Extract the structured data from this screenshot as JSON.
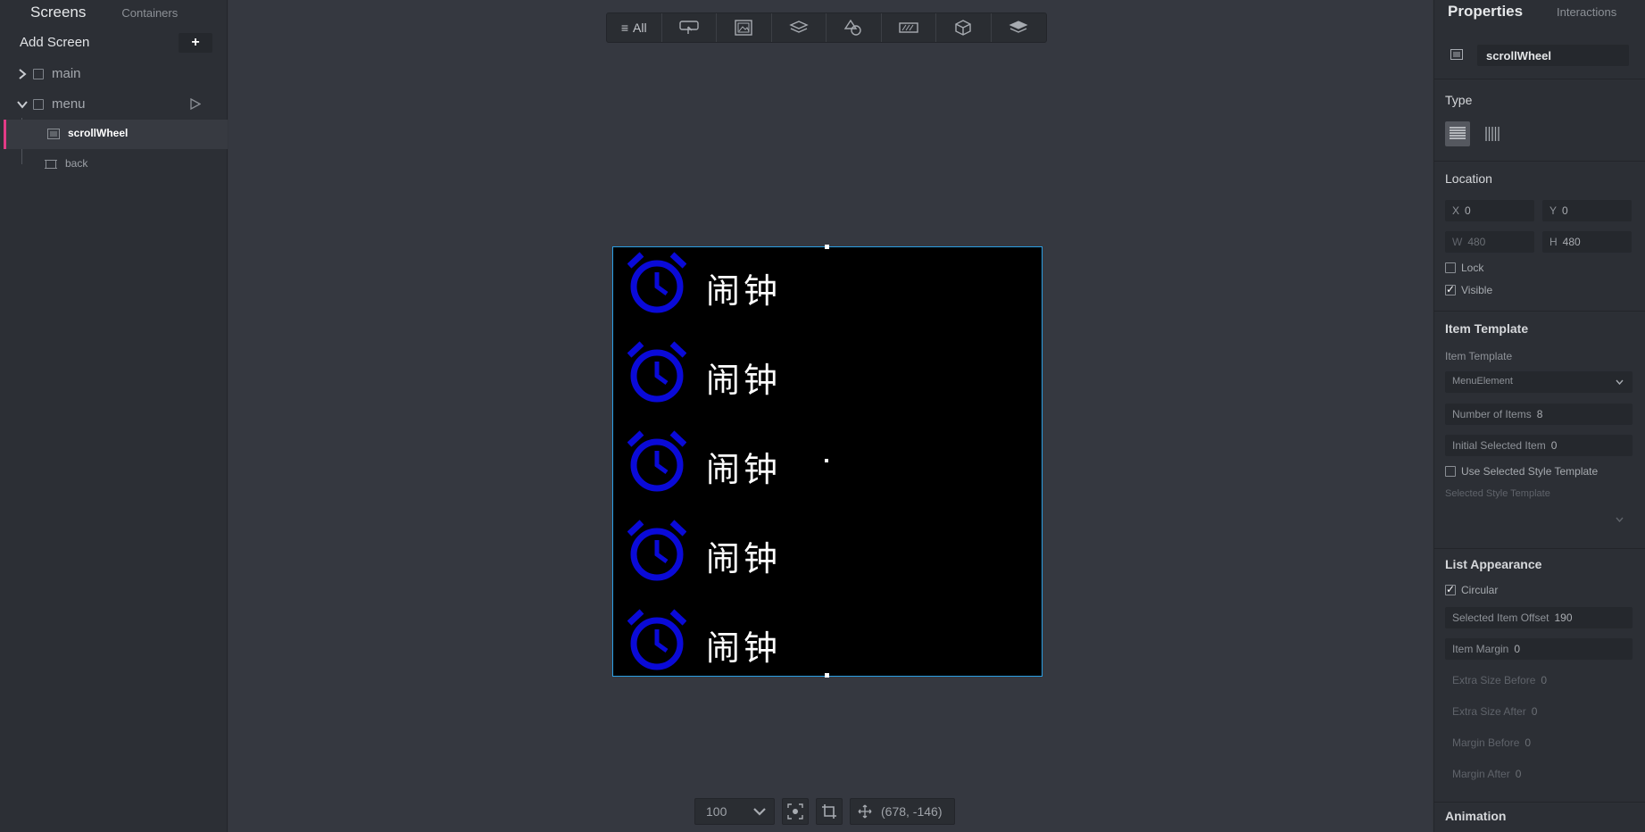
{
  "left_panel": {
    "tab_screens": "Screens",
    "tab_containers": "Containers",
    "add_screen": "Add Screen",
    "screens": [
      {
        "name": "main"
      },
      {
        "name": "menu"
      }
    ],
    "children": [
      {
        "name": "scrollWheel"
      },
      {
        "name": "back"
      }
    ]
  },
  "toolbar": {
    "all_label": "All"
  },
  "canvas": {
    "item_text": "闹钟",
    "item_icon": "alarm-clock-icon",
    "icon_color": "#0a0ad8"
  },
  "zoom": {
    "value": "100",
    "coords": "(678, -146)"
  },
  "properties": {
    "tab_properties": "Properties",
    "tab_interactions": "Interactions",
    "widget_name": "scrollWheel",
    "type_label": "Type",
    "location_label": "Location",
    "x_label": "X",
    "x_value": "0",
    "y_label": "Y",
    "y_value": "0",
    "w_label": "W",
    "w_value": "480",
    "h_label": "H",
    "h_value": "480",
    "lock_label": "Lock",
    "visible_label": "Visible",
    "item_template_section": "Item Template",
    "item_template_label": "Item Template",
    "item_template_value": "MenuElement",
    "num_items_label": "Number of Items",
    "num_items_value": "8",
    "initial_selected_label": "Initial Selected Item",
    "initial_selected_value": "0",
    "use_selected_style_label": "Use Selected Style Template",
    "selected_style_label": "Selected Style Template",
    "list_appearance_label": "List Appearance",
    "circular_label": "Circular",
    "selected_offset_label": "Selected Item Offset",
    "selected_offset_value": "190",
    "item_margin_label": "Item Margin",
    "item_margin_value": "0",
    "extra_before_label": "Extra Size Before",
    "extra_before_value": "0",
    "extra_after_label": "Extra Size After",
    "extra_after_value": "0",
    "margin_before_label": "Margin Before",
    "margin_before_value": "0",
    "margin_after_label": "Margin After",
    "margin_after_value": "0",
    "animation_label": "Animation"
  }
}
